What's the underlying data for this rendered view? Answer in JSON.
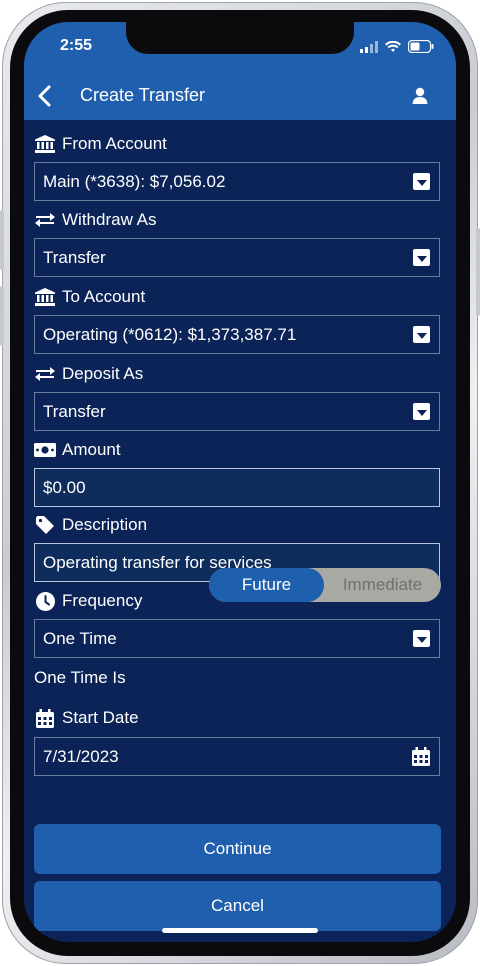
{
  "status": {
    "time": "2:55"
  },
  "header": {
    "title": "Create Transfer"
  },
  "form": {
    "from_account": {
      "label": "From Account",
      "value": "Main (*3638): $7,056.02"
    },
    "withdraw_as": {
      "label": "Withdraw As",
      "value": "Transfer"
    },
    "to_account": {
      "label": "To Account",
      "value": "Operating (*0612): $1,373,387.71"
    },
    "deposit_as": {
      "label": "Deposit As",
      "value": "Transfer"
    },
    "amount": {
      "label": "Amount",
      "value": "$0.00"
    },
    "description": {
      "label": "Description",
      "value": "Operating transfer for services"
    },
    "frequency": {
      "label": "Frequency",
      "value": "One Time"
    },
    "one_time_is": {
      "label": "One Time Is",
      "options": [
        "Future",
        "Immediate"
      ],
      "selected": "Future"
    },
    "start_date": {
      "label": "Start Date",
      "value": "7/31/2023"
    }
  },
  "buttons": {
    "continue": "Continue",
    "cancel": "Cancel"
  },
  "icons": {
    "from_account": "bank-icon",
    "withdraw_as": "exchange-icon",
    "to_account": "bank-icon",
    "deposit_as": "exchange-icon",
    "amount": "money-bill-icon",
    "description": "tag-icon",
    "frequency": "clock-icon",
    "start_date": "calendar-icon"
  },
  "colors": {
    "background": "#0b2356",
    "header": "#1f5fad",
    "accent": "#1e5fae",
    "toggle_off": "#a7a9a2"
  }
}
